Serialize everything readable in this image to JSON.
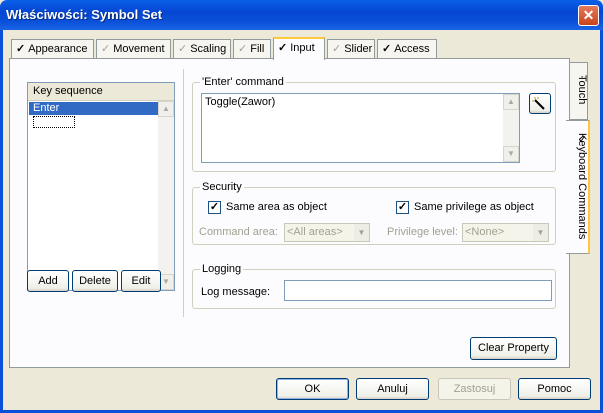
{
  "window": {
    "title": "Właściwości: Symbol Set",
    "close_label": "✕"
  },
  "tabs": [
    {
      "label": "Appearance",
      "check": "✓"
    },
    {
      "label": "Movement",
      "check": "✓"
    },
    {
      "label": "Scaling",
      "check": "✓"
    },
    {
      "label": "Fill",
      "check": "✓"
    },
    {
      "label": "Input",
      "check": "✓"
    },
    {
      "label": "Slider",
      "check": "✓"
    },
    {
      "label": "Access",
      "check": "✓"
    }
  ],
  "vtabs": [
    {
      "label": "Touch",
      "check": "·"
    },
    {
      "label": "Keyboard Commands",
      "check": "✓"
    }
  ],
  "keys": {
    "header": "Key sequence",
    "items": [
      "Enter",
      ""
    ]
  },
  "buttons": {
    "add": "Add",
    "delete": "Delete",
    "edit": "Edit",
    "clear": "Clear Property",
    "ok": "OK",
    "cancel": "Anuluj",
    "apply": "Zastosuj",
    "help": "Pomoc"
  },
  "enter_command": {
    "legend": "'Enter' command",
    "value": "Toggle(Zawor)"
  },
  "security": {
    "legend": "Security",
    "same_area": "Same area as object",
    "same_privilege": "Same privilege as object",
    "command_area_label": "Command area:",
    "command_area_value": "<All areas>",
    "privilege_label": "Privilege level:",
    "privilege_value": "<None>"
  },
  "logging": {
    "legend": "Logging",
    "label": "Log message:",
    "value": ""
  }
}
